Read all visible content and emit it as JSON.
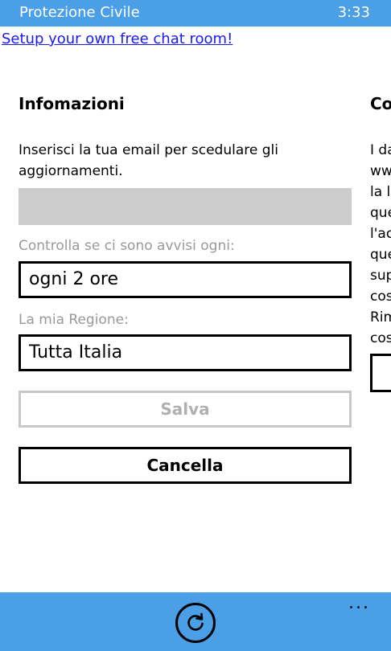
{
  "status_bar": {
    "title": "Protezione Civile",
    "time": "3:33"
  },
  "ad": {
    "link_text": "Setup your own free chat room!"
  },
  "pane_info": {
    "title": "Infomazioni",
    "description": "Inserisci la tua email per scedulare gli aggiornamenti.",
    "email_value": "",
    "interval_label": "Controlla se ci sono avvisi ogni:",
    "interval_value": "ogni 2 ore",
    "region_label": "La mia Regione:",
    "region_value": "Tutta Italia",
    "save_label": "Salva",
    "cancel_label": "Cancella"
  },
  "pane_next": {
    "title_partial": "Co",
    "lines_partial": [
      "I da",
      "ww",
      "la l",
      "que",
      "l'ac",
      "que",
      "sup",
      "cos",
      "Rim",
      "cos"
    ]
  },
  "app_bar": {
    "refresh_icon": "refresh-icon",
    "more": "..."
  },
  "colors": {
    "accent": "#4a9fe6",
    "disabled_text": "#b0b0b0",
    "input_fill": "#cccccc",
    "label_gray": "#999999"
  }
}
